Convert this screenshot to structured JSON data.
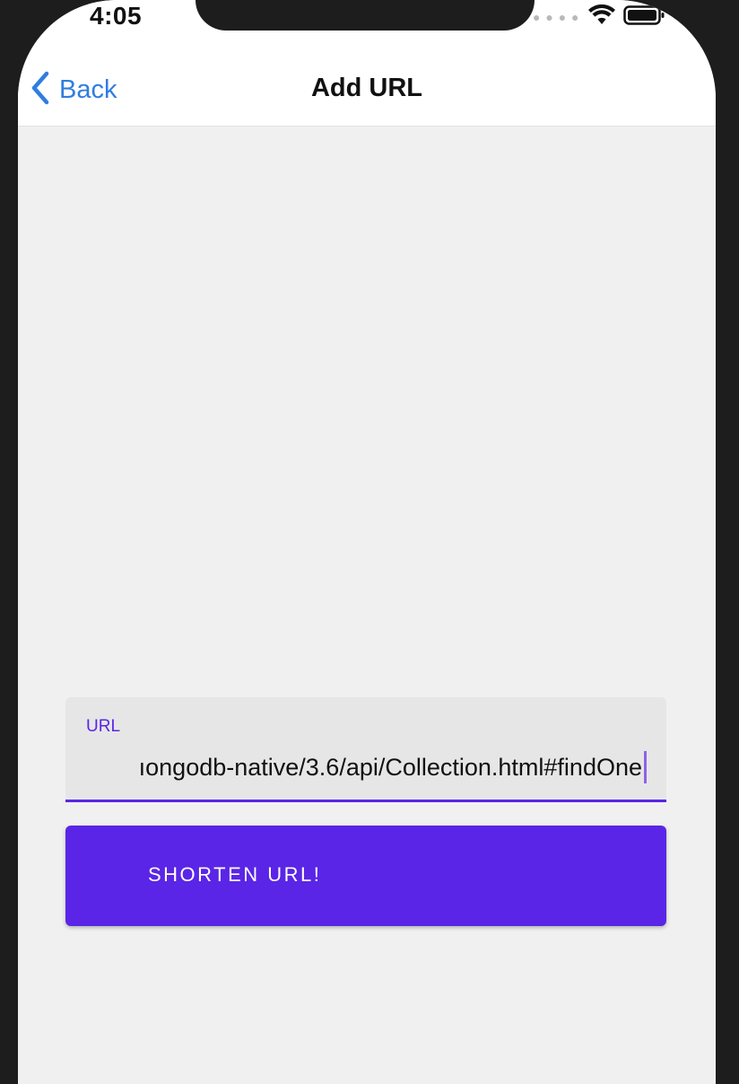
{
  "status_bar": {
    "time": "4:05",
    "signal_icon": "cellular-dots-icon",
    "wifi_icon": "wifi-icon",
    "battery_icon": "battery-icon"
  },
  "nav": {
    "back_label": "Back",
    "back_icon": "chevron-left-icon",
    "title": "Add URL"
  },
  "form": {
    "url_label": "URL",
    "url_value": "ıongodb-native/3.6/api/Collection.html#findOne",
    "submit_label": "SHORTEN URL!"
  },
  "colors": {
    "accent": "#5a25e6",
    "link": "#2f7de1",
    "background": "#f0f0f0",
    "field_background": "#e6e6e6"
  }
}
